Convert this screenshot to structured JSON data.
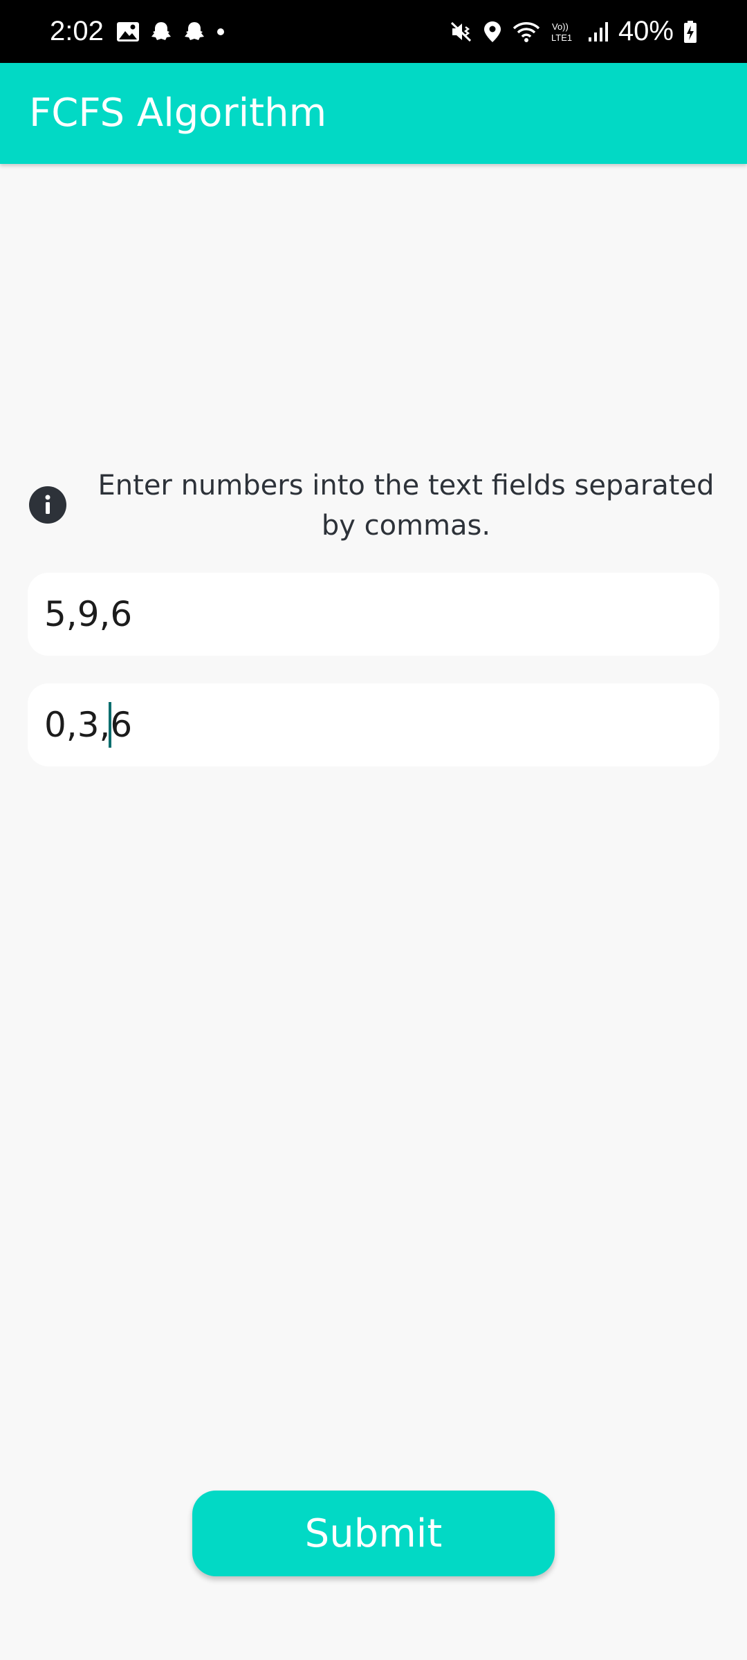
{
  "status_bar": {
    "time": "2:02",
    "battery_percent": "40%",
    "left_icons": [
      "gallery-icon",
      "snapchat-icon",
      "snapchat-icon",
      "dot-icon"
    ],
    "right_icons": [
      "vibrate-mute-icon",
      "location-icon",
      "wifi-icon",
      "volte-lte-icon",
      "signal-icon",
      "battery-charging-icon"
    ],
    "volte_label": "Vo)) LTE1"
  },
  "app_bar": {
    "title": "FCFS Algorithm",
    "color": "#02d9c5"
  },
  "hint": {
    "icon": "info-icon",
    "text": "Enter numbers into the text fields separated by commas."
  },
  "fields": {
    "field_1_value": "5,9,6",
    "field_2_value_before_cursor": "0,3,",
    "field_2_value_after_cursor": "6"
  },
  "submit": {
    "label": "Submit"
  },
  "colors": {
    "accent": "#02d9c5",
    "background": "#f8f8f8",
    "text": "#2d3239"
  }
}
